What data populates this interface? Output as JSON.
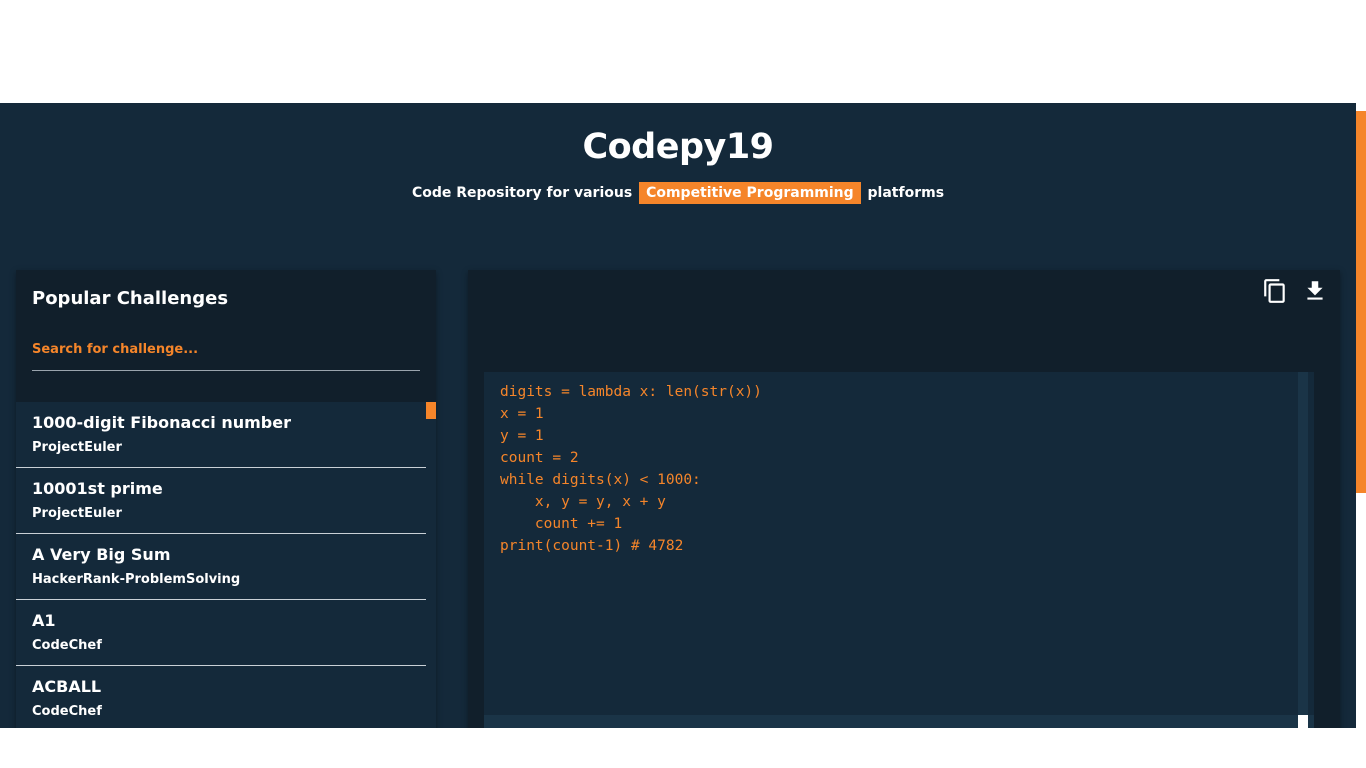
{
  "header": {
    "title": "Codepy19",
    "tagline_pre": "Code Repository for various",
    "tagline_highlight": "Competitive Programming",
    "tagline_post": "platforms"
  },
  "sidebar": {
    "title": "Popular Challenges",
    "search_placeholder": "Search for challenge...",
    "items": [
      {
        "title": "1000-digit Fibonacci number",
        "platform": "ProjectEuler"
      },
      {
        "title": "10001st prime",
        "platform": "ProjectEuler"
      },
      {
        "title": "A Very Big Sum",
        "platform": "HackerRank-ProblemSolving"
      },
      {
        "title": "A1",
        "platform": "CodeChef"
      },
      {
        "title": "ACBALL",
        "platform": "CodeChef"
      }
    ]
  },
  "code_panel": {
    "copy_icon": "copy-icon",
    "download_icon": "download-icon",
    "code": "digits = lambda x: len(str(x))\nx = 1\ny = 1\ncount = 2\nwhile digits(x) < 1000:\n    x, y = y, x + y\n    count += 1\nprint(count-1) # 4782"
  },
  "colors": {
    "background": "#14293a",
    "panel": "#111f2b",
    "accent": "#f5852a",
    "text": "#ffffff"
  }
}
